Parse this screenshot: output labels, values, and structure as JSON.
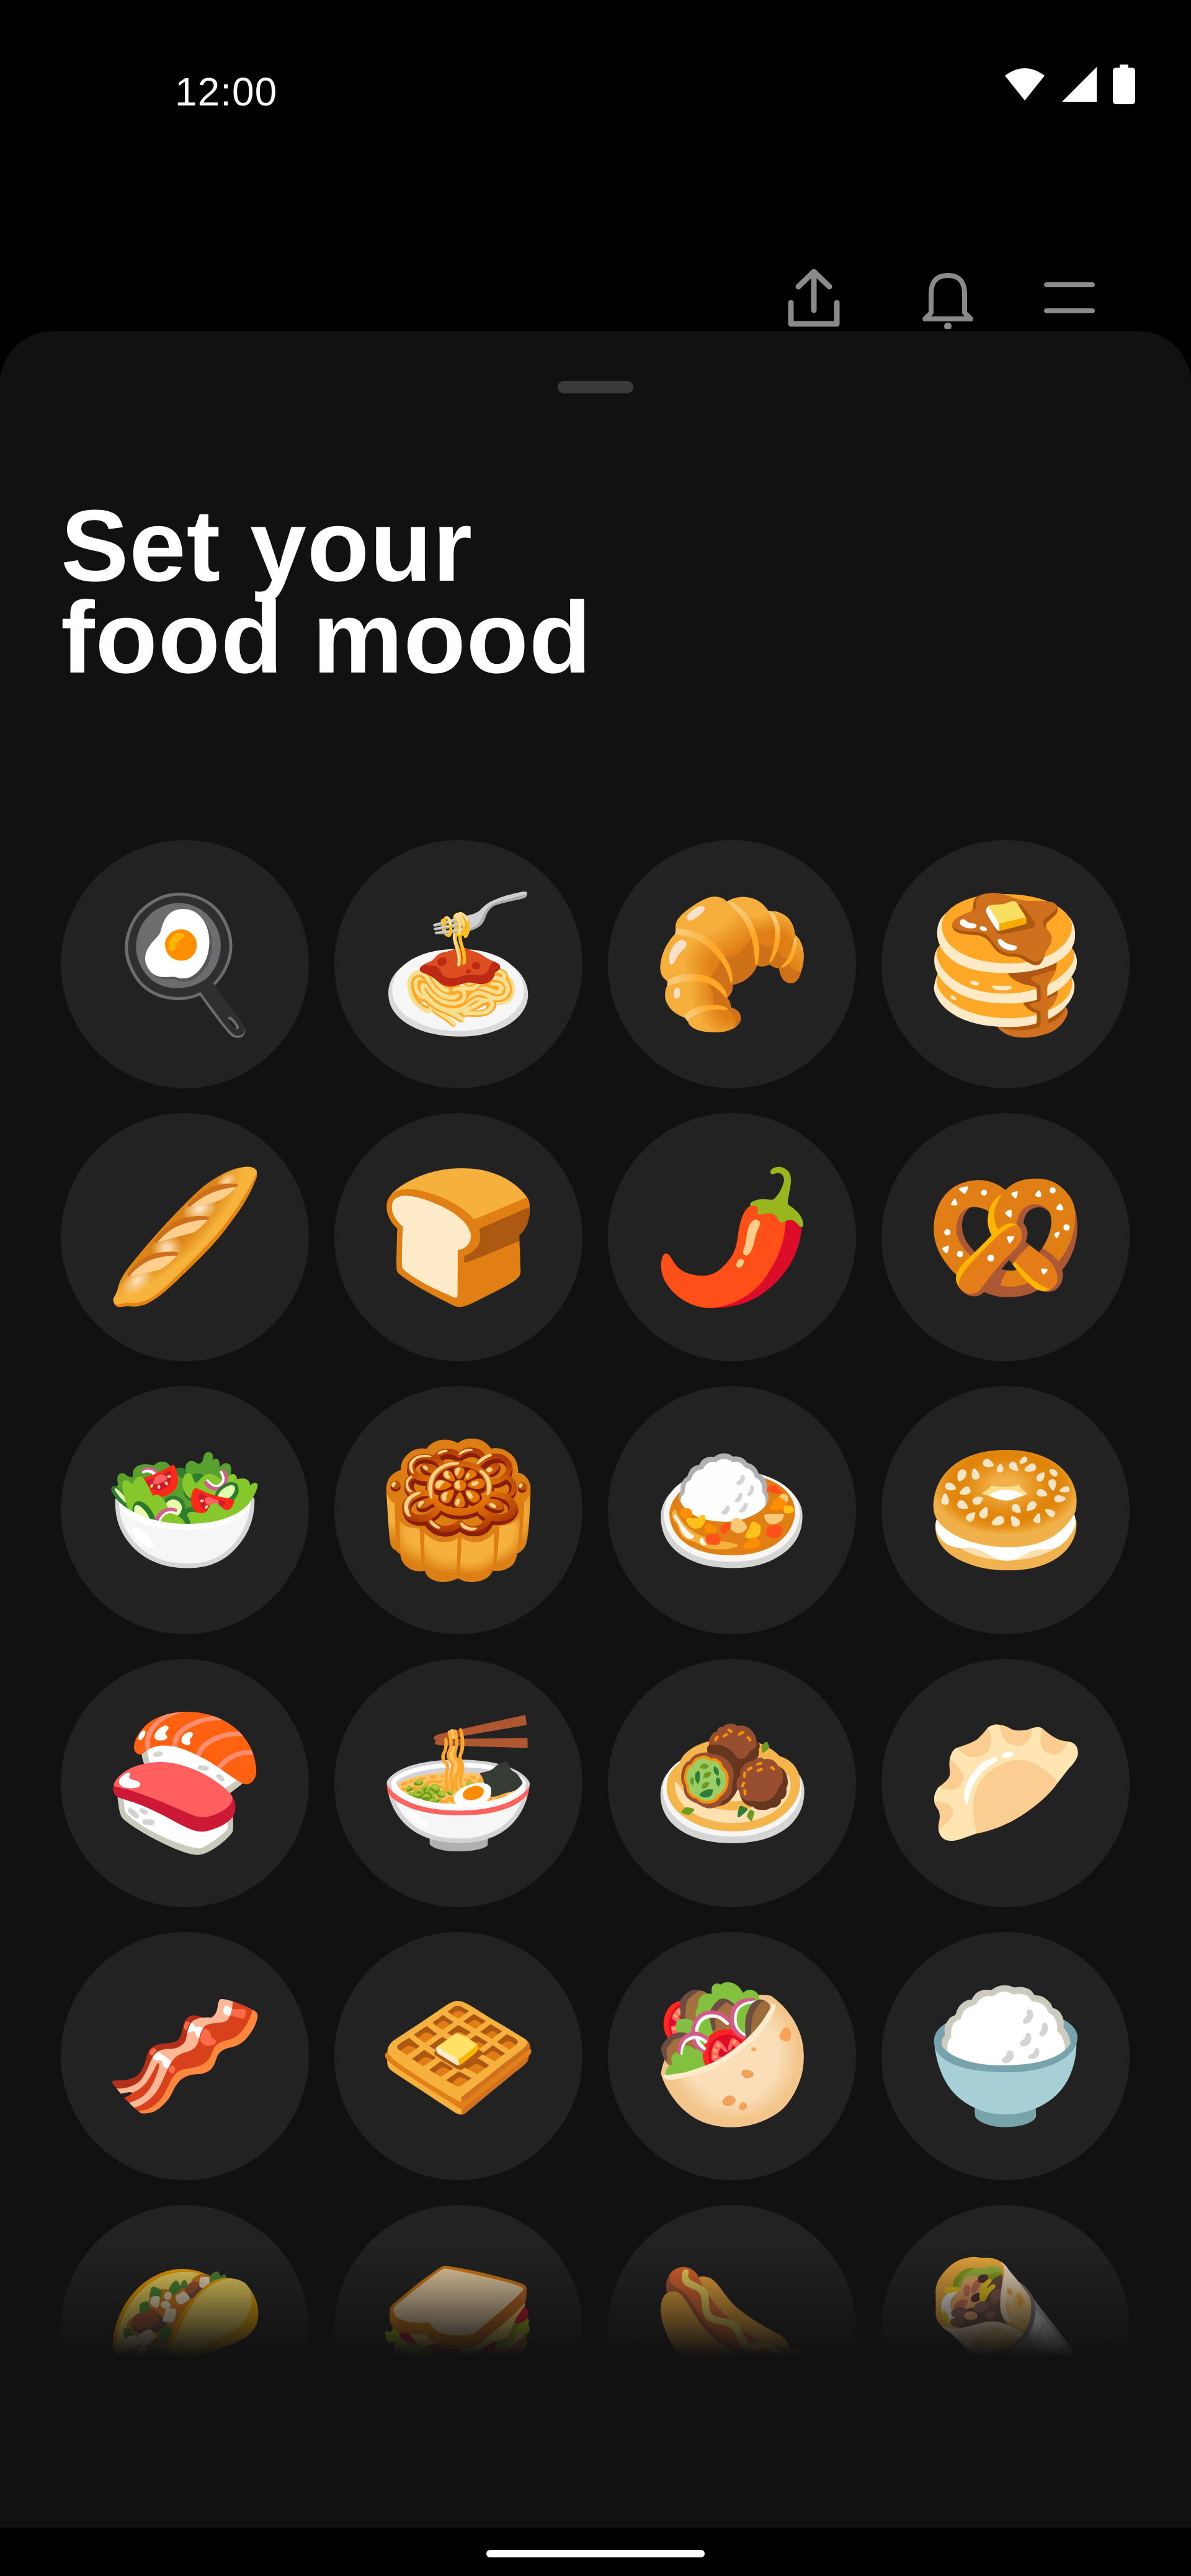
{
  "status_bar": {
    "time": "12:00",
    "icons": [
      "wifi-icon",
      "cellular-signal-icon",
      "battery-icon"
    ]
  },
  "toolbar": {
    "actions": [
      "share-icon",
      "notifications-icon",
      "menu-icon"
    ]
  },
  "sheet": {
    "title_line1": "Set your",
    "title_line2": "food mood",
    "foods": [
      {
        "id": "cooking",
        "emoji": "🍳"
      },
      {
        "id": "spaghetti",
        "emoji": "🍝"
      },
      {
        "id": "croissant",
        "emoji": "🥐"
      },
      {
        "id": "pancakes",
        "emoji": "🥞"
      },
      {
        "id": "baguette",
        "emoji": "🥖"
      },
      {
        "id": "bread",
        "emoji": "🍞"
      },
      {
        "id": "hot-pepper",
        "emoji": "🌶️"
      },
      {
        "id": "pretzel",
        "emoji": "🥨"
      },
      {
        "id": "salad",
        "emoji": "🥗"
      },
      {
        "id": "moon-cake",
        "emoji": "🥮"
      },
      {
        "id": "curry-rice",
        "emoji": "🍛"
      },
      {
        "id": "bagel",
        "emoji": "🥯"
      },
      {
        "id": "sushi",
        "emoji": "🍣"
      },
      {
        "id": "ramen",
        "emoji": "🍜"
      },
      {
        "id": "falafel",
        "emoji": "🧆"
      },
      {
        "id": "dumpling",
        "emoji": "🥟"
      },
      {
        "id": "bacon",
        "emoji": "🥓"
      },
      {
        "id": "waffle",
        "emoji": "🧇"
      },
      {
        "id": "stuffed-flatbread",
        "emoji": "🥙"
      },
      {
        "id": "cooked-rice",
        "emoji": "🍚"
      },
      {
        "id": "taco",
        "emoji": "🌮"
      },
      {
        "id": "sandwich",
        "emoji": "🥪"
      },
      {
        "id": "hot-dog",
        "emoji": "🌭"
      },
      {
        "id": "burrito",
        "emoji": "🌯"
      }
    ]
  },
  "colors": {
    "background": "#000000",
    "sheet": "#111111",
    "tile": "#222222",
    "text": "#ffffff",
    "icon": "#8a8a8a"
  }
}
